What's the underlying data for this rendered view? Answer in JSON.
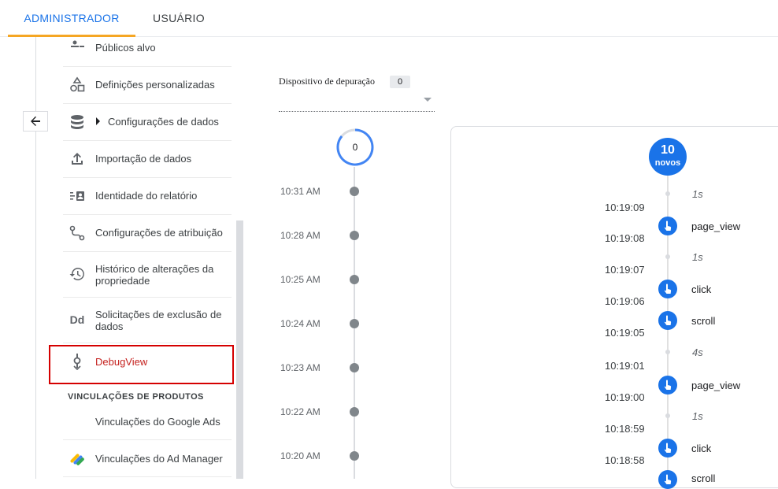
{
  "tabs": [
    {
      "label": "ADMINISTRADOR",
      "active": true
    },
    {
      "label": "USUÁRIO",
      "active": false
    }
  ],
  "nav": {
    "items": [
      {
        "label": "Públicos alvo",
        "icon": "audience-icon"
      },
      {
        "label": "Definições personalizadas",
        "icon": "shapes-icon"
      },
      {
        "label": "Configurações de dados",
        "icon": "database-icon",
        "expandable": true
      },
      {
        "label": "Importação de dados",
        "icon": "upload-icon"
      },
      {
        "label": "Identidade do relatório",
        "icon": "reporting-identity-icon"
      },
      {
        "label": "Configurações de atribuição",
        "icon": "attribution-icon"
      },
      {
        "label": "Histórico de alterações da propriedade",
        "icon": "history-icon"
      },
      {
        "label": "Solicitações de exclusão de dados",
        "icon": "data-deletion-icon"
      },
      {
        "label": "DebugView",
        "icon": "debugview-icon",
        "highlighted": true
      }
    ],
    "section_header": "VINCULAÇÕES DE PRODUTOS",
    "product_links": [
      {
        "label": "Vinculações do Google Ads",
        "icon": ""
      },
      {
        "label": "Vinculações do Ad Manager",
        "icon": "ad-manager-icon"
      }
    ]
  },
  "debug": {
    "device_label": "Dispositivo de depuração",
    "device_count": "0",
    "minutes_count": "0",
    "minutes": [
      "10:31 AM",
      "10:28 AM",
      "10:25 AM",
      "10:24 AM",
      "10:23 AM",
      "10:22 AM",
      "10:20 AM"
    ],
    "seconds_badge": {
      "number": "10",
      "label": "novos"
    },
    "gaps": [
      "1s",
      "1s",
      "4s",
      "1s"
    ],
    "events": [
      "page_view",
      "click",
      "scroll",
      "page_view",
      "click",
      "scroll"
    ],
    "times": [
      "10:19:09",
      "10:19:08",
      "10:19:07",
      "10:19:06",
      "10:19:05",
      "10:19:01",
      "10:19:00",
      "10:18:59",
      "10:18:58"
    ]
  },
  "colors": {
    "accent": "#1a73e8",
    "tab_underline": "#f5a623",
    "highlight_border": "#d50000",
    "debug_text": "#c5221f"
  }
}
